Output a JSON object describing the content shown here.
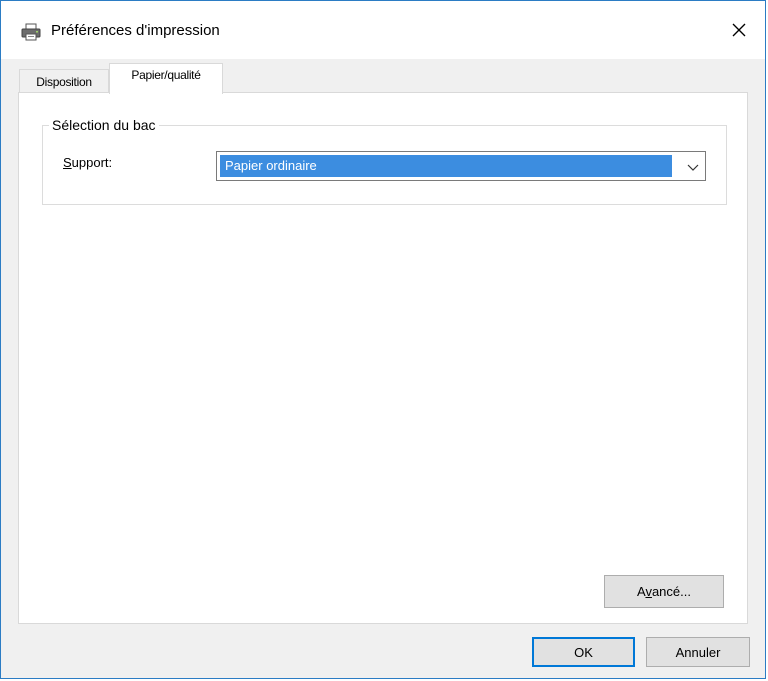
{
  "window": {
    "title": "Préférences d'impression",
    "icon": "printer-icon",
    "close_icon": "close-icon"
  },
  "tabs": [
    {
      "label": "Disposition",
      "active": false
    },
    {
      "label": "Papier/qualité",
      "active": true
    }
  ],
  "tray_group": {
    "legend": "Sélection du bac",
    "support_label_first": "S",
    "support_label_rest": "upport:",
    "support_value": "Papier ordinaire"
  },
  "buttons": {
    "advanced_first": "A",
    "advanced_underlined": "v",
    "advanced_rest": "ancé...",
    "ok": "OK",
    "cancel": "Annuler"
  },
  "colors": {
    "selection": "#3c8de0",
    "focus_border": "#0078d7",
    "window_border": "#2b7cc4"
  }
}
